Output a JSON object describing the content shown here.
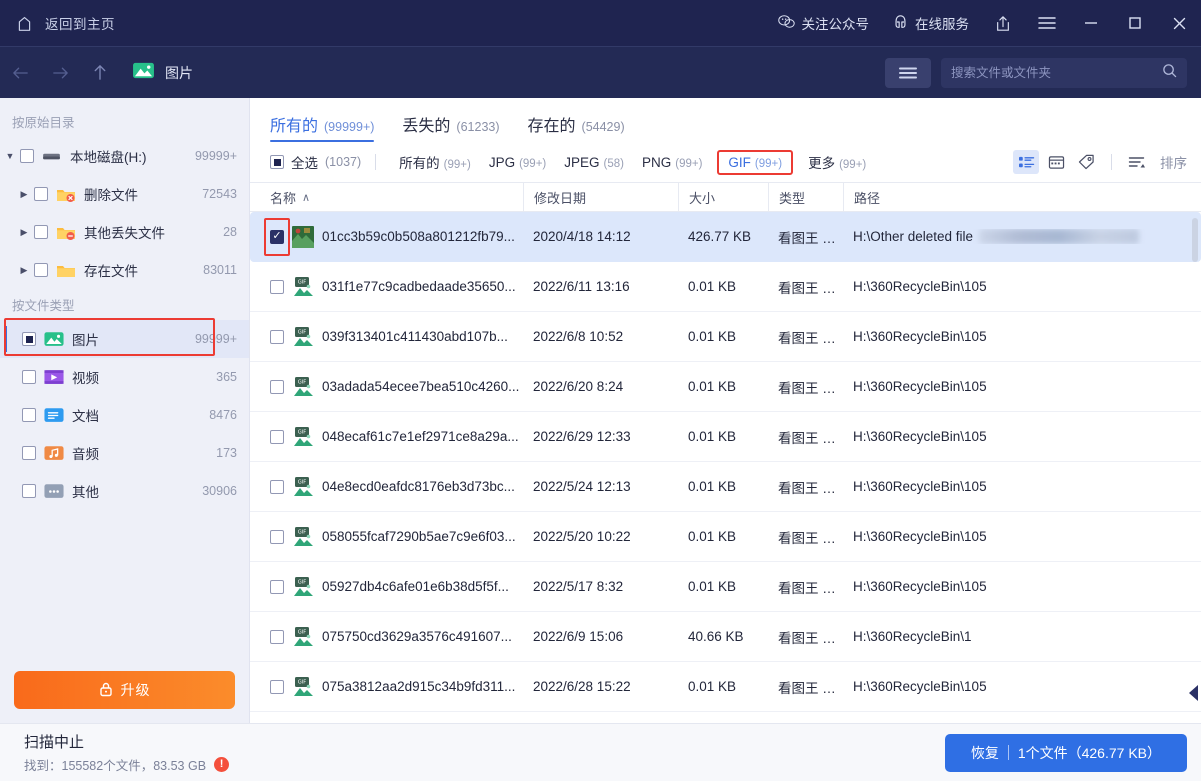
{
  "titlebar": {
    "home_label": "返回到主页",
    "wechat_label": "关注公众号",
    "service_label": "在线服务",
    "icons": {
      "home": "home-icon",
      "wechat": "wechat-icon",
      "service": "headset-icon",
      "share": "share-icon",
      "menu": "hamburger-icon",
      "minimize": "minimize-icon",
      "maximize": "maximize-icon",
      "close": "close-icon"
    }
  },
  "navbar": {
    "back": "←",
    "forward": "→",
    "up": "↑",
    "breadcrumb": "图片",
    "search_placeholder": "搜索文件或文件夹",
    "search_value": ""
  },
  "sidebar": {
    "group1_title": "按原始目录",
    "tree": [
      {
        "label": "本地磁盘(H:)",
        "count": "99999+",
        "icon": "disk-icon",
        "expanded": true,
        "level": 0,
        "checkbox": "unchecked"
      },
      {
        "label": "删除文件",
        "count": "72543",
        "icon": "folder-deleted-icon",
        "expanded": false,
        "level": 1,
        "checkbox": "unchecked"
      },
      {
        "label": "其他丢失文件",
        "count": "28",
        "icon": "folder-lost-icon",
        "expanded": false,
        "level": 1,
        "checkbox": "unchecked"
      },
      {
        "label": "存在文件",
        "count": "83011",
        "icon": "folder-icon",
        "expanded": false,
        "level": 1,
        "checkbox": "unchecked"
      }
    ],
    "group2_title": "按文件类型",
    "types": [
      {
        "label": "图片",
        "count": "99999+",
        "icon": "image-icon",
        "checkbox": "partial",
        "selected": true
      },
      {
        "label": "视频",
        "count": "365",
        "icon": "video-icon",
        "checkbox": "unchecked",
        "selected": false
      },
      {
        "label": "文档",
        "count": "8476",
        "icon": "document-icon",
        "checkbox": "unchecked",
        "selected": false
      },
      {
        "label": "音频",
        "count": "173",
        "icon": "audio-icon",
        "checkbox": "unchecked",
        "selected": false
      },
      {
        "label": "其他",
        "count": "30906",
        "icon": "other-icon",
        "checkbox": "unchecked",
        "selected": false
      }
    ],
    "upgrade_label": "升级"
  },
  "tabs": [
    {
      "label": "所有的",
      "count": "(99999+)",
      "active": true
    },
    {
      "label": "丢失的",
      "count": "(61233)",
      "active": false
    },
    {
      "label": "存在的",
      "count": "(54429)",
      "active": false
    }
  ],
  "filters": {
    "select_all_label": "全选",
    "select_all_count": "(1037)",
    "chips": [
      {
        "label": "所有的",
        "count": "(99+)",
        "active": false,
        "highlight": false
      },
      {
        "label": "JPG",
        "count": "(99+)",
        "active": false,
        "highlight": false
      },
      {
        "label": "JPEG",
        "count": "(58)",
        "active": false,
        "highlight": false
      },
      {
        "label": "PNG",
        "count": "(99+)",
        "active": false,
        "highlight": false
      },
      {
        "label": "GIF",
        "count": "(99+)",
        "active": true,
        "highlight": true
      },
      {
        "label": "更多",
        "count": "(99+)",
        "active": false,
        "highlight": false
      }
    ],
    "sort_label": "排序",
    "view_icons": [
      "list-view-icon",
      "thumbnail-view-icon",
      "tag-icon",
      "sort-icon"
    ]
  },
  "table": {
    "columns": [
      {
        "label": "名称",
        "sort": "∧"
      },
      {
        "label": "修改日期",
        "sort": ""
      },
      {
        "label": "大小",
        "sort": ""
      },
      {
        "label": "类型",
        "sort": ""
      },
      {
        "label": "路径",
        "sort": ""
      }
    ],
    "rows": [
      {
        "name": "01cc3b59c0b508a801212fb79...",
        "date": "2020/4/18 14:12",
        "size": "426.77 KB",
        "type": "看图王 GI...",
        "path": "H:\\Other deleted file",
        "checked": true,
        "selected": true,
        "blurred": true
      },
      {
        "name": "031f1e77c9cadbedaade35650...",
        "date": "2022/6/11 13:16",
        "size": "0.01 KB",
        "type": "看图王 GI...",
        "path": "H:\\360RecycleBin\\105",
        "checked": false,
        "selected": false,
        "blurred": false
      },
      {
        "name": "039f313401c411430abd107b...",
        "date": "2022/6/8 10:52",
        "size": "0.01 KB",
        "type": "看图王 GI...",
        "path": "H:\\360RecycleBin\\105",
        "checked": false,
        "selected": false,
        "blurred": false
      },
      {
        "name": "03adada54ecee7bea510c4260...",
        "date": "2022/6/20 8:24",
        "size": "0.01 KB",
        "type": "看图王 GI...",
        "path": "H:\\360RecycleBin\\105",
        "checked": false,
        "selected": false,
        "blurred": false
      },
      {
        "name": "048ecaf61c7e1ef2971ce8a29a...",
        "date": "2022/6/29 12:33",
        "size": "0.01 KB",
        "type": "看图王 GI...",
        "path": "H:\\360RecycleBin\\105",
        "checked": false,
        "selected": false,
        "blurred": false
      },
      {
        "name": "04e8ecd0eafdc8176eb3d73bc...",
        "date": "2022/5/24 12:13",
        "size": "0.01 KB",
        "type": "看图王 GI...",
        "path": "H:\\360RecycleBin\\105",
        "checked": false,
        "selected": false,
        "blurred": false
      },
      {
        "name": "058055fcaf7290b5ae7c9e6f03...",
        "date": "2022/5/20 10:22",
        "size": "0.01 KB",
        "type": "看图王 GI...",
        "path": "H:\\360RecycleBin\\105",
        "checked": false,
        "selected": false,
        "blurred": false
      },
      {
        "name": "05927db4c6afe01e6b38d5f5f...",
        "date": "2022/5/17 8:32",
        "size": "0.01 KB",
        "type": "看图王 GI...",
        "path": "H:\\360RecycleBin\\105",
        "checked": false,
        "selected": false,
        "blurred": false
      },
      {
        "name": "075750cd3629a3576c491607...",
        "date": "2022/6/9 15:06",
        "size": "40.66 KB",
        "type": "看图王 GI...",
        "path": "H:\\360RecycleBin\\1",
        "checked": false,
        "selected": false,
        "blurred": false
      },
      {
        "name": "075a3812aa2d915c34b9fd311...",
        "date": "2022/6/28 15:22",
        "size": "0.01 KB",
        "type": "看图王 GI...",
        "path": "H:\\360RecycleBin\\105",
        "checked": false,
        "selected": false,
        "blurred": false
      }
    ]
  },
  "status": {
    "title": "扫描中止",
    "summary": "找到：155582个文件，83.53 GB",
    "recover_label": "恢复",
    "recover_detail": "1个文件（426.77 KB）"
  },
  "colors": {
    "titlebar": "#1f2450",
    "navbar": "#232a55",
    "accent": "#3b6fe0",
    "highlight_red": "#ec3b33",
    "upgrade_orange": "#f96a1b",
    "row_selected": "#dce7fb"
  }
}
